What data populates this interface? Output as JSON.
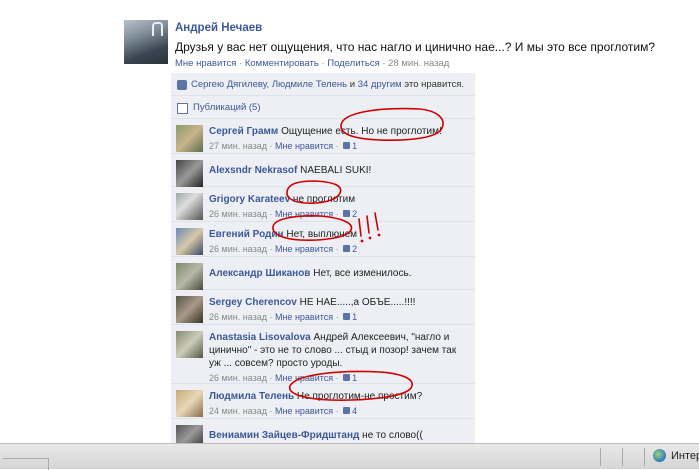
{
  "post": {
    "author": "Андрей Нечаев",
    "text": "Друзья у вас нет ощущения, что нас нагло и цинично нае...? И мы это все проглотим?",
    "actions": {
      "like": "Мне нравится",
      "sep1": " · ",
      "comment": "Комментировать",
      "sep2": " · ",
      "share": "Поделиться",
      "time": " · 28 мин. назад"
    }
  },
  "likes": {
    "link_names": "Сергею Дягилеву, Людмиле Телень",
    "and": " и ",
    "others": "34 другим",
    "suffix": " это нравится."
  },
  "publications": "Публикаций (5)",
  "comments": [
    {
      "name": "Сергей Грамм",
      "text": " Ощущение есть. Но не проглотим!",
      "time": "27 мин. назад",
      "like": "Мне нравится",
      "likes": "1"
    },
    {
      "name": "Alexsndr Nekrasof",
      "text": " NAEBALI SUKI!",
      "time": "",
      "like": "",
      "likes": ""
    },
    {
      "name": "Grigory Karateev",
      "text": " не проглотим",
      "time": "26 мин. назад",
      "like": "Мне нравится",
      "likes": "2"
    },
    {
      "name": "Евгений Родин",
      "text": " Нет, выплюнем",
      "time": "26 мин. назад",
      "like": "Мне нравится",
      "likes": "2"
    },
    {
      "name": "Александр Шиканов",
      "text": " Нет, все изменилось.",
      "time": "",
      "like": "",
      "likes": ""
    },
    {
      "name": "Sergey Cherencov",
      "text": " НЕ НАЕ.....,а ОБЪЕ.....!!!!",
      "time": "26 мин. назад",
      "like": "Мне нравится",
      "likes": "1"
    },
    {
      "name": "Anastasia Lisovalova",
      "text": " Андрей Алексеевич, \"нагло и цинично\" - это не то слово ... стыд и позор! зачем так уж ... совсем? просто уроды.",
      "time": "26 мин. назад",
      "like": "Мне нравится",
      "likes": "1"
    },
    {
      "name": "Людмила Телень",
      "text": " Не проглотим-не простим?",
      "time": "24 мин. назад",
      "like": "Мне нравится",
      "likes": "4"
    },
    {
      "name": "Вениамин Зайцев-Фридштанд",
      "text": " не то слово((",
      "time": "",
      "like": "",
      "likes": ""
    }
  ],
  "status_bar": {
    "zone_label": "Интер",
    "icon": "globe-icon"
  },
  "colors": {
    "link": "#3b5998",
    "panel": "#edeff4",
    "annotation": "#d00000"
  }
}
